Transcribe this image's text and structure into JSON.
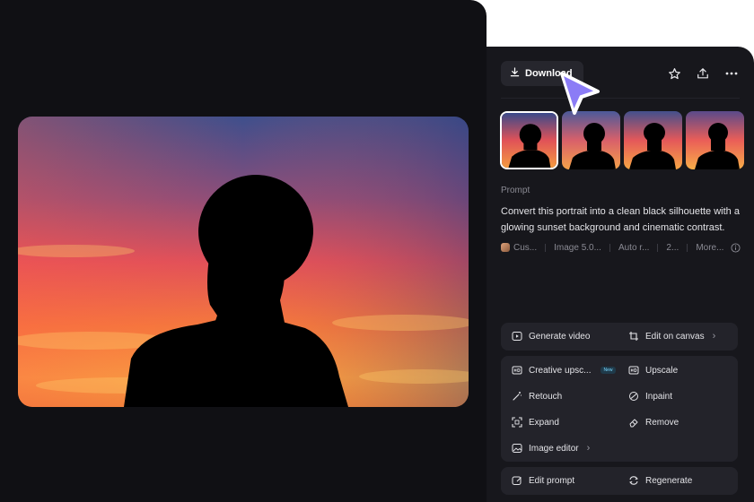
{
  "toolbar": {
    "download_label": "Download",
    "icons": [
      "download-icon",
      "star-icon",
      "share-icon",
      "more-icon"
    ]
  },
  "thumbnails": [
    "thumb-1",
    "thumb-2",
    "thumb-3",
    "thumb-4"
  ],
  "prompt": {
    "label": "Prompt",
    "text": "Convert this portrait into a clean black silhouette with a glowing sunset background and cinematic contrast."
  },
  "meta": {
    "items": [
      "Cus...",
      "Image 5.0...",
      "Auto r...",
      "2...",
      "More..."
    ]
  },
  "actions": {
    "generate_video": "Generate video",
    "edit_on_canvas": "Edit on canvas",
    "creative_upscale": "Creative upsc...",
    "new_badge": "New",
    "upscale": "Upscale",
    "retouch": "Retouch",
    "inpaint": "Inpaint",
    "expand": "Expand",
    "remove": "Remove",
    "image_editor": "Image editor",
    "edit_prompt": "Edit prompt",
    "regenerate": "Regenerate"
  },
  "colors": {
    "panel_bg": "#17171c",
    "canvas_bg": "#101014",
    "card_bg": "#23232a",
    "cursor_accent": "#8b7cf6"
  }
}
